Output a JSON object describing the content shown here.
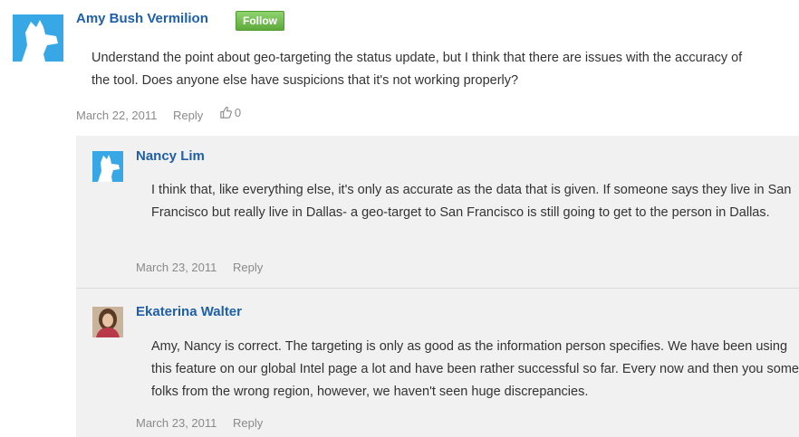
{
  "comment": {
    "author": "Amy Bush Vermilion",
    "follow_label": "Follow",
    "text": "Understand the point about geo-targeting the status update, but I think that there are issues with the accuracy of the tool. Does anyone else have suspicions that it's not working properly?",
    "date": "March 22, 2011",
    "reply_label": "Reply",
    "likes": "0"
  },
  "replies": [
    {
      "author": "Nancy Lim",
      "text": "I think that, like everything else, it's only as accurate as the data that is given. If someone says they live in San Francisco but really live in Dallas- a geo-target to San Francisco is still going to get to the person in Dallas.",
      "date": "March 23, 2011",
      "reply_label": "Reply"
    },
    {
      "author": "Ekaterina Walter",
      "text": "Amy, Nancy is correct. The targeting is only as good as the information person specifies. We have been using this feature on our global Intel page a lot and have been rather successful so far. Every now and then you some folks from the wrong region, however, we haven't seen huge discrepancies.",
      "date": "March 23, 2011",
      "reply_label": "Reply"
    }
  ],
  "colors": {
    "author_link": "#1f5fa8",
    "follow_button": "#5eaa3b",
    "avatar_placeholder": "#37a7e6",
    "reply_background": "#f1f1f1"
  },
  "icons": [
    "default-avatar-icon",
    "thumbs-up-icon",
    "user-photo-avatar"
  ]
}
